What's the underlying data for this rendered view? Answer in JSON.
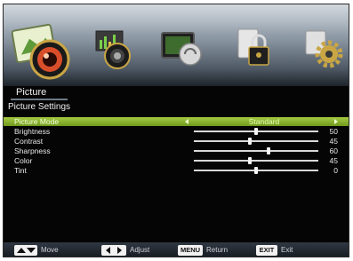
{
  "menu": {
    "icons": [
      {
        "name": "picture-camera-icon",
        "selected": true
      },
      {
        "name": "sound-speaker-icon",
        "selected": false
      },
      {
        "name": "screen-setup-icon",
        "selected": false
      },
      {
        "name": "lock-icon",
        "selected": false
      },
      {
        "name": "settings-gear-icon",
        "selected": false
      }
    ],
    "category_title": "Picture",
    "section_title": "Picture Settings"
  },
  "settings": {
    "picture_mode": {
      "label": "Picture Mode",
      "value": "Standard"
    },
    "brightness": {
      "label": "Brightness",
      "value": "50",
      "level": 50
    },
    "contrast": {
      "label": "Contrast",
      "value": "45",
      "level": 45
    },
    "sharpness": {
      "label": "Sharpness",
      "value": "60",
      "level": 60
    },
    "color": {
      "label": "Color",
      "value": "45",
      "level": 45
    },
    "tint": {
      "label": "Tint",
      "value": "0",
      "level": 0,
      "centered": true
    }
  },
  "help": {
    "move": "Move",
    "adjust": "Adjust",
    "menu_key": "MENU",
    "return": "Return",
    "exit_key": "EXIT",
    "exit": "Exit"
  },
  "colors": {
    "selection": "#8db533",
    "background": "#050505"
  }
}
